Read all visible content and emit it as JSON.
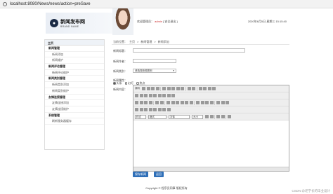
{
  "browser": {
    "url": "localhost:8080/News/news/action=preSave"
  },
  "header": {
    "logo_cn": "新闻发布网",
    "logo_en": "BRAND NAME",
    "welcome_prefix": "欢迎管理员：",
    "admin_name": "admin",
    "logout": "[ 安全退出 ]",
    "datetime": "2020年6月5日 星期三 15:15:40"
  },
  "sidebar": {
    "head": "主页",
    "items": [
      {
        "label": "新闻管理",
        "type": "group"
      },
      {
        "label": "新闻添加",
        "type": "sub"
      },
      {
        "label": "新闻维护",
        "type": "sub"
      },
      {
        "label": "新闻评论管理",
        "type": "group"
      },
      {
        "label": "新闻评论维护",
        "type": "sub"
      },
      {
        "label": "新闻类别管理",
        "type": "group"
      },
      {
        "label": "新闻类别添加",
        "type": "sub"
      },
      {
        "label": "新闻类别维护",
        "type": "sub"
      },
      {
        "label": "友情连接管理",
        "type": "group"
      },
      {
        "label": "友情连接添加",
        "type": "sub"
      },
      {
        "label": "友情连接维护",
        "type": "sub"
      },
      {
        "label": "系统管理",
        "type": "group"
      },
      {
        "label": "刷新服务器缓存",
        "type": "sub"
      }
    ]
  },
  "breadcrumb": {
    "prefix": "当前位置：",
    "items": [
      "主页",
      "新闻管理",
      "新闻添加"
    ]
  },
  "form": {
    "title_label": "新闻标题：",
    "author_label": "新闻作者：",
    "category_label": "新闻类别：",
    "category_value": "请选择新闻类别",
    "attr_label": "新闻属性：",
    "attrs": [
      "头条",
      "幻灯",
      "热点"
    ],
    "content_label": "新闻内容：",
    "editor": {
      "source": "源码",
      "style": "样式",
      "format": "格式",
      "font": "字体",
      "size": "大小"
    },
    "save_button": "保存新闻",
    "back_button": "返回"
  },
  "footer": {
    "copyright": "Copyright © 程序员同事 版权所有",
    "watermark": "CSDN @老学长的毕业设计"
  }
}
